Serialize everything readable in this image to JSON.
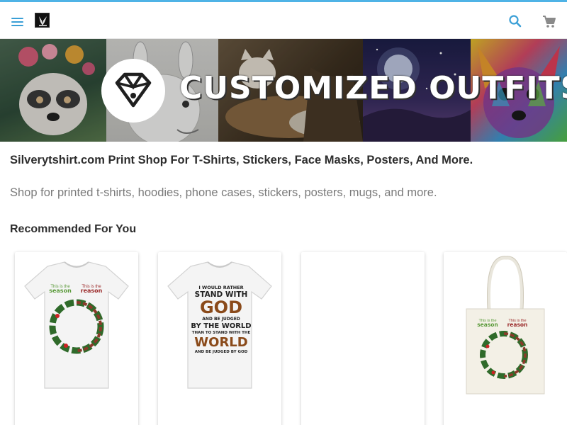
{
  "header": {
    "menu_icon": "menu-icon",
    "logo_icon": "brand-logo-icon",
    "search_icon": "search-icon",
    "cart_icon": "shopping-cart-icon",
    "accent_color": "#3a9fd6"
  },
  "banner": {
    "title": "CUSTOMIZED OUTFITS",
    "emblem_icon": "diamond-heart-logo-icon"
  },
  "shop": {
    "title": "Silverytshirt.com Print Shop For T-Shirts, Stickers, Face Masks, Posters, And More.",
    "subtitle": "Shop for printed t-shirts, hoodies, phone cases, stickers, posters, mugs, and more."
  },
  "recommended": {
    "heading": "Recommended For You",
    "products": [
      {
        "kind": "t-shirt",
        "print_left_small": "This is the",
        "print_left_big": "season",
        "print_right_small": "This is the",
        "print_right_big": "reason"
      },
      {
        "kind": "t-shirt",
        "lines": [
          "I WOULD RATHER",
          "STAND WITH",
          "GOD",
          "AND BE JUDGED",
          "BY THE WORLD",
          "THAN TO STAND WITH THE",
          "WORLD",
          "AND BE JUDGED BY GOD"
        ]
      },
      {
        "kind": "blank"
      },
      {
        "kind": "tote-bag",
        "print_left_small": "This is the",
        "print_left_big": "season",
        "print_right_small": "This is the",
        "print_right_big": "reason"
      }
    ]
  }
}
